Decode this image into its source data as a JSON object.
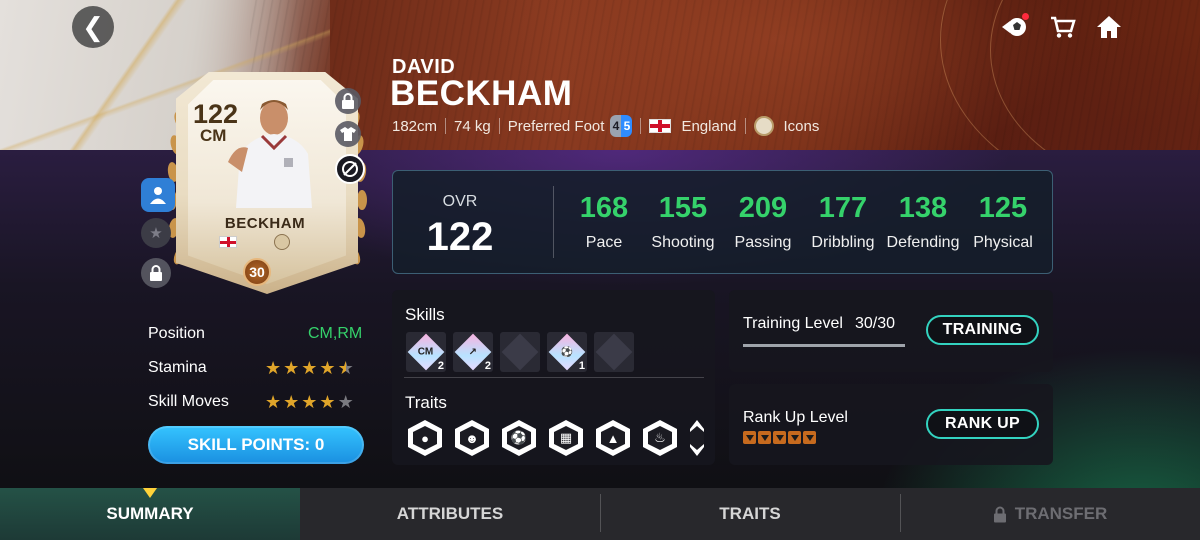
{
  "player": {
    "first_name": "DAVID",
    "last_name": "BECKHAM",
    "height": "182cm",
    "weight": "74 kg",
    "preferred_foot_label": "Preferred Foot",
    "foot_left": "4",
    "foot_right": "5",
    "nation": "England",
    "league": "Icons"
  },
  "card": {
    "ovr": "122",
    "position": "CM",
    "name": "BECKHAM",
    "level": "30"
  },
  "stats": {
    "ovr_label": "OVR",
    "ovr_value": "122",
    "items": [
      {
        "value": "168",
        "label": "Pace"
      },
      {
        "value": "155",
        "label": "Shooting"
      },
      {
        "value": "209",
        "label": "Passing"
      },
      {
        "value": "177",
        "label": "Dribbling"
      },
      {
        "value": "138",
        "label": "Defending"
      },
      {
        "value": "125",
        "label": "Physical"
      }
    ],
    "value_color": "#35d26b"
  },
  "skills": {
    "title": "Skills",
    "items": [
      {
        "icon": "cm-skill-icon",
        "text": "CM",
        "count": "2"
      },
      {
        "icon": "pass-skill-icon",
        "text": "",
        "count": "2"
      },
      {
        "icon": "locked-skill-icon",
        "text": "",
        "count": ""
      },
      {
        "icon": "shot-skill-icon",
        "text": "",
        "count": "1"
      },
      {
        "icon": "locked-skill-icon",
        "text": "",
        "count": ""
      }
    ]
  },
  "traits": {
    "title": "Traits",
    "icons": [
      "ball-trait-icon",
      "player-trait-icon",
      "ball-shot-trait-icon",
      "goal-net-trait-icon",
      "ball-stand-trait-icon",
      "ball-bell-trait-icon",
      "ball-foot-trait-icon"
    ]
  },
  "training": {
    "label": "Training Level",
    "value": "30/30",
    "progress": 1.0,
    "button": "TRAINING"
  },
  "rank": {
    "label": "Rank Up Level",
    "gems": 5,
    "button": "RANK UP",
    "gem_color": "#c66a1e"
  },
  "info": {
    "position_label": "Position",
    "position_value": "CM,RM",
    "position_color": "#35d26b",
    "stamina_label": "Stamina",
    "stamina_rating": 4.5,
    "skill_moves_label": "Skill Moves",
    "skill_moves_rating": 4,
    "skill_points_button": "SKILL POINTS: 0"
  },
  "tabs": [
    {
      "label": "SUMMARY",
      "active": true
    },
    {
      "label": "ATTRIBUTES",
      "active": false
    },
    {
      "label": "TRAITS",
      "active": false
    },
    {
      "label": "TRANSFER",
      "active": false,
      "locked": true
    }
  ],
  "nav_icons": [
    "back-icon",
    "ball-notification-icon",
    "cart-icon",
    "home-icon"
  ],
  "colors": {
    "accent_cyan": "#33d3c0",
    "skill_points_blue": "#1a8fe0",
    "star_gold": "#e0a52a"
  }
}
